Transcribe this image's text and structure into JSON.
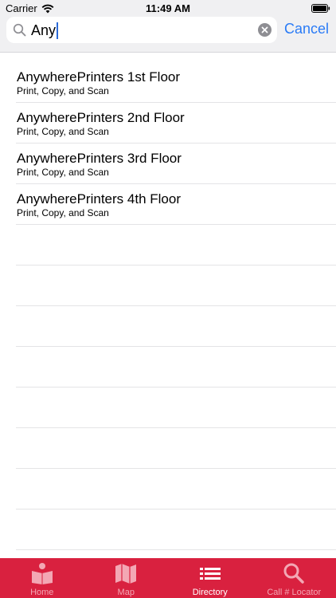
{
  "status_bar": {
    "carrier": "Carrier",
    "time": "11:49 AM"
  },
  "search": {
    "value": "Any",
    "cancel_label": "Cancel"
  },
  "results": [
    {
      "title": "AnywherePrinters 1st Floor",
      "subtitle": "Print, Copy, and Scan"
    },
    {
      "title": "AnywherePrinters 2nd Floor",
      "subtitle": "Print, Copy, and Scan"
    },
    {
      "title": "AnywherePrinters 3rd Floor",
      "subtitle": "Print, Copy, and Scan"
    },
    {
      "title": "AnywherePrinters 4th Floor",
      "subtitle": "Print, Copy, and Scan"
    }
  ],
  "tab_bar": {
    "background": "#d9213f",
    "tabs": [
      {
        "label": "Home",
        "icon": "home-book-icon",
        "active": false
      },
      {
        "label": "Map",
        "icon": "map-icon",
        "active": false
      },
      {
        "label": "Directory",
        "icon": "list-icon",
        "active": true
      },
      {
        "label": "Call # Locator",
        "icon": "search-icon",
        "active": false
      }
    ]
  },
  "colors": {
    "accent_blue": "#2a7bf6",
    "tab_active": "#ffffff",
    "tab_inactive": "#f3a7b4"
  }
}
